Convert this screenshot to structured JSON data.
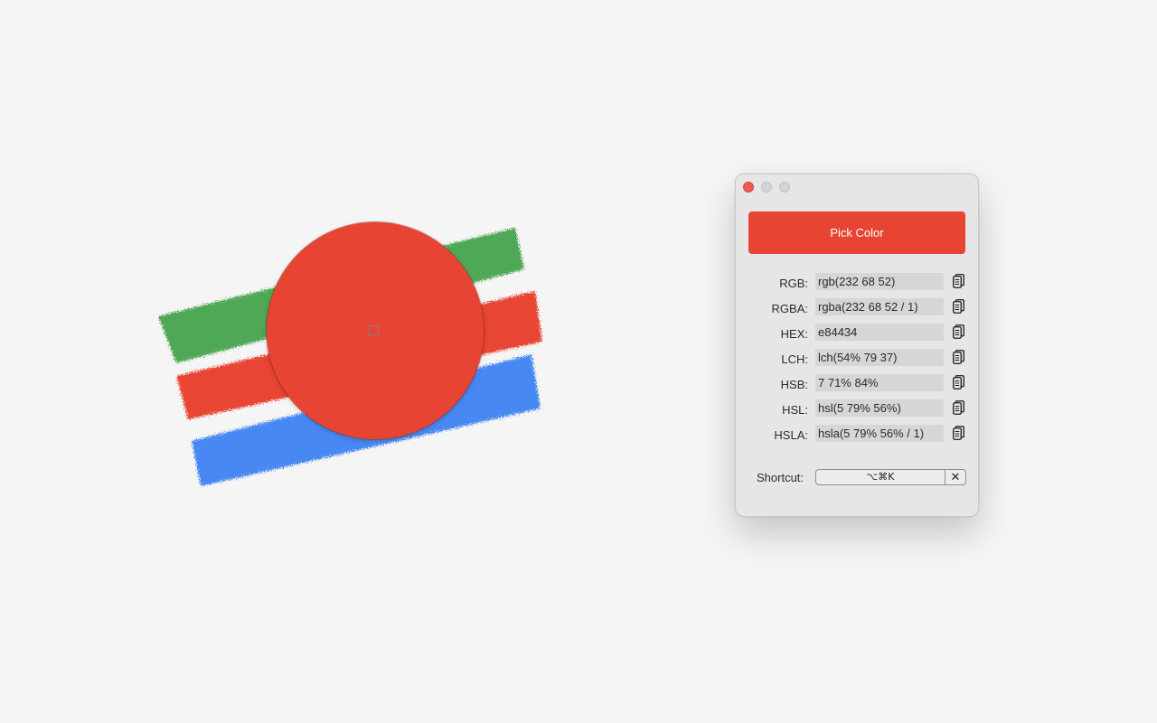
{
  "colors": {
    "picked": "#e84434",
    "stroke_green": "#4fa856",
    "stroke_red": "#e84434",
    "stroke_blue": "#4688f3"
  },
  "window": {
    "pick_button_label": "Pick Color",
    "formats": [
      {
        "label": "RGB:",
        "value": "rgb(232 68 52)"
      },
      {
        "label": "RGBA:",
        "value": "rgba(232 68 52 / 1)"
      },
      {
        "label": "HEX:",
        "value": "e84434"
      },
      {
        "label": "LCH:",
        "value": "lch(54% 79 37)"
      },
      {
        "label": "HSB:",
        "value": "7 71% 84%"
      },
      {
        "label": "HSL:",
        "value": "hsl(5 79% 56%)"
      },
      {
        "label": "HSLA:",
        "value": "hsla(5 79% 56% / 1)"
      }
    ],
    "copy_icon": "copy-icon",
    "shortcut_label": "Shortcut:",
    "shortcut_value": "⌥⌘K",
    "shortcut_clear": "✕"
  }
}
